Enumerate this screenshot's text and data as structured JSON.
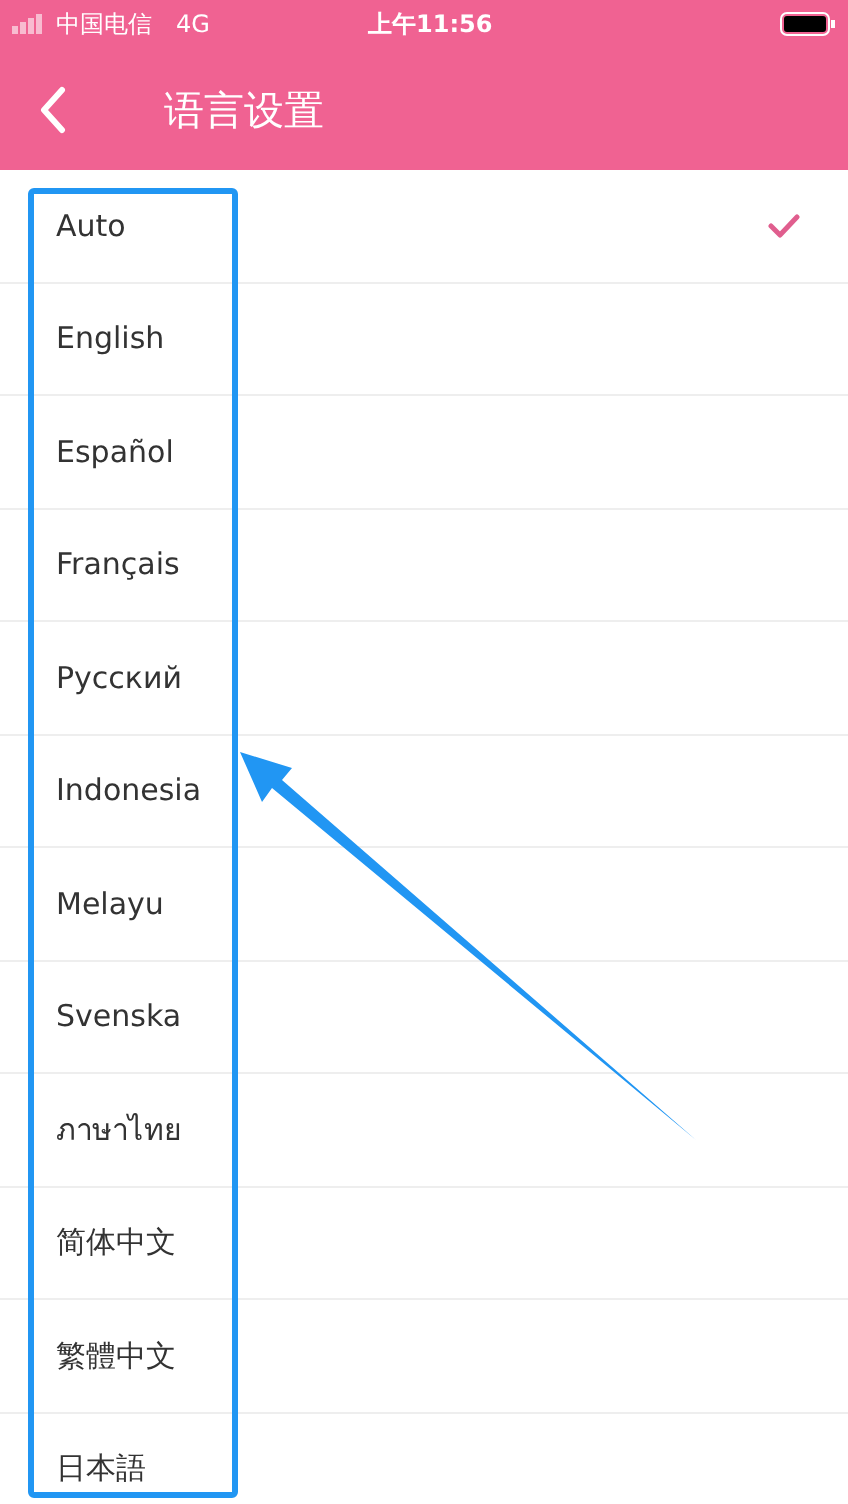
{
  "status_bar": {
    "carrier": "中国电信",
    "network": "4G",
    "time": "上午11:56"
  },
  "nav": {
    "title": "语言设置"
  },
  "languages": [
    {
      "label": "Auto",
      "selected": true
    },
    {
      "label": "English",
      "selected": false
    },
    {
      "label": "Español",
      "selected": false
    },
    {
      "label": "Français",
      "selected": false
    },
    {
      "label": "Русский",
      "selected": false
    },
    {
      "label": "Indonesia",
      "selected": false
    },
    {
      "label": "Melayu",
      "selected": false
    },
    {
      "label": "Svenska",
      "selected": false
    },
    {
      "label": "ภาษาไทย",
      "selected": false
    },
    {
      "label": "简体中文",
      "selected": false
    },
    {
      "label": "繁體中文",
      "selected": false
    },
    {
      "label": "日本語",
      "selected": false
    }
  ]
}
